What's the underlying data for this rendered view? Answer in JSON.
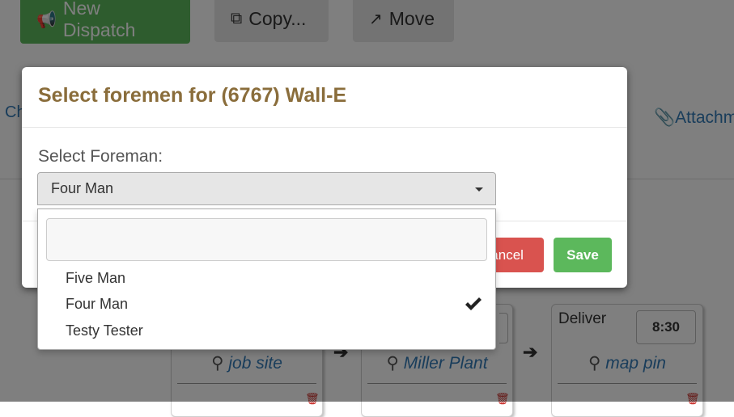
{
  "toolbar": {
    "new_dispatch_label": "New Dispatch",
    "copy_label": "Copy...",
    "move_label": "Move"
  },
  "background": {
    "left_link_partial": "Ch",
    "attachments_label": "Attachm",
    "cards": [
      {
        "location": "job site"
      },
      {
        "location": "Miller Plant"
      },
      {
        "deliver_label": "Deliver",
        "time": "8:30",
        "location": "map pin"
      }
    ]
  },
  "modal": {
    "title": "Select foremen for (6767) Wall-E",
    "field_label": "Select Foreman:",
    "selected_value": "Four Man",
    "cancel_label": "Cancel",
    "save_label": "Save"
  },
  "dropdown": {
    "search_value": "",
    "options": [
      {
        "label": "Five Man",
        "selected": false
      },
      {
        "label": "Four Man",
        "selected": true
      },
      {
        "label": "Testy Tester",
        "selected": false
      }
    ]
  },
  "colors": {
    "success": "#5cb85c",
    "danger": "#d9534f",
    "title": "#8a6d3b",
    "link": "#337ab7"
  },
  "icons": [
    "bullhorn-icon",
    "copy-icon",
    "share-icon",
    "paperclip-icon",
    "map-marker-icon",
    "trash-icon",
    "arrow-right-icon",
    "caret-down-icon",
    "checkmark-icon"
  ]
}
